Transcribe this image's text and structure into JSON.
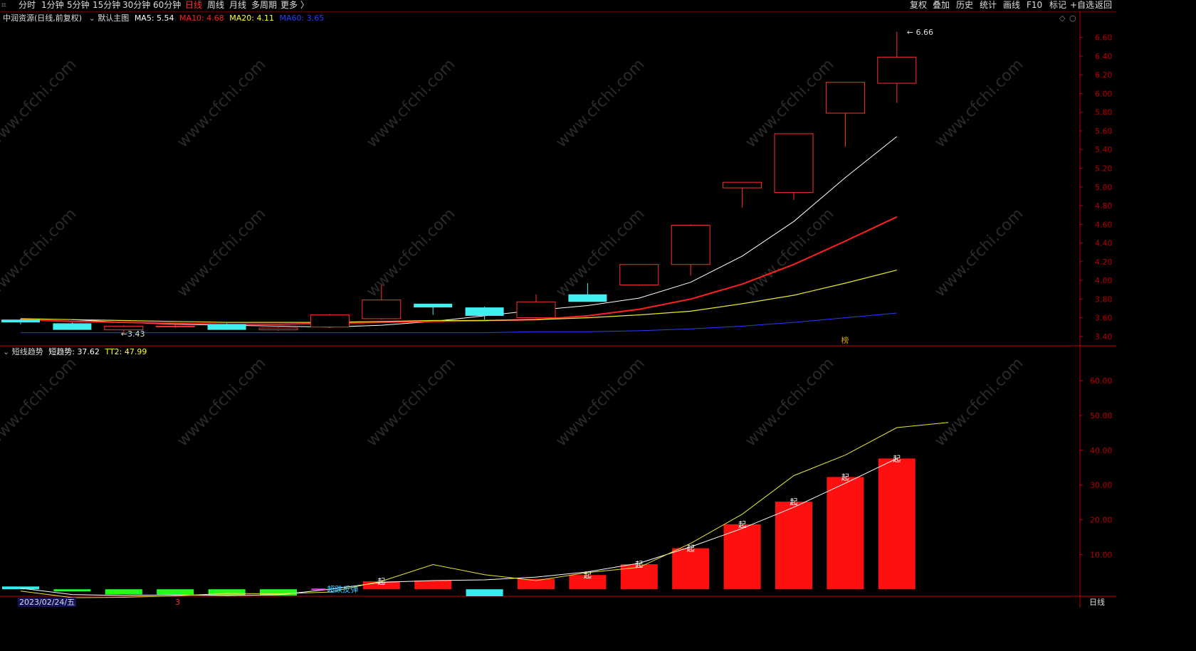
{
  "toolbar": {
    "periods": [
      "分时",
      "1分钟",
      "5分钟",
      "15分钟",
      "30分钟",
      "60分钟",
      "日线",
      "周线",
      "月线",
      "多周期",
      "更多 〉"
    ],
    "selected_period": "日线",
    "right_buttons": [
      "复权",
      "叠加",
      "历史",
      "统计",
      "画线",
      "F10",
      "标记",
      "+自选",
      "返回"
    ]
  },
  "main_header": {
    "stock": "中润资源(日线,前复权)",
    "template": "默认主图",
    "ma": [
      {
        "label": "MA5:",
        "value": "5.54",
        "color": "#ffffff"
      },
      {
        "label": "MA10:",
        "value": "4.68",
        "color": "#ff2020"
      },
      {
        "label": "MA20:",
        "value": "4.11",
        "color": "#ffff33"
      },
      {
        "label": "MA60:",
        "value": "3.65",
        "color": "#2a3cff"
      }
    ]
  },
  "sub_header": {
    "name": "短线趋势",
    "items": [
      {
        "label": "短趋势:",
        "value": "37.62",
        "color": "#ffffff"
      },
      {
        "label": "TT2:",
        "value": "47.99",
        "color": "#ffff33"
      }
    ]
  },
  "annotations": {
    "high_label": "6.66",
    "low_label": "3.43",
    "board_label": "榜",
    "signal_char": "起",
    "signal_text": "超跌反弹"
  },
  "date_axis": {
    "current_date": "2023/02/24/五",
    "marker": "3"
  },
  "bottom_right_label": "日线",
  "watermark": "www.cfchi.com",
  "colors": {
    "up": "#ff3030",
    "down": "#40f0f0",
    "axis": "#b80000",
    "ma5": "#ffffff",
    "ma10": "#ff2020",
    "ma20": "#e8e830",
    "ma60": "#2a3cff",
    "bar_up": "#ff1010",
    "bar_down": "#20ff20",
    "bar_flat": "#30f0f0"
  },
  "chart_data": [
    {
      "type": "candlestick",
      "title": "中润资源(日线,前复权)",
      "ylim": [
        3.33,
        6.75
      ],
      "y_ticks": [
        3.4,
        3.6,
        3.8,
        4.0,
        4.2,
        4.4,
        4.6,
        4.8,
        5.0,
        5.2,
        5.4,
        5.6,
        5.8,
        6.0,
        6.2,
        6.4,
        6.6
      ],
      "candles": [
        {
          "o": 3.58,
          "h": 3.59,
          "l": 3.53,
          "c": 3.55
        },
        {
          "o": 3.54,
          "h": 3.55,
          "l": 3.47,
          "c": 3.47
        },
        {
          "o": 3.47,
          "h": 3.52,
          "l": 3.43,
          "c": 3.51
        },
        {
          "o": 3.51,
          "h": 3.53,
          "l": 3.49,
          "c": 3.51
        },
        {
          "o": 3.53,
          "h": 3.54,
          "l": 3.47,
          "c": 3.47
        },
        {
          "o": 3.47,
          "h": 3.5,
          "l": 3.46,
          "c": 3.49
        },
        {
          "o": 3.5,
          "h": 3.64,
          "l": 3.49,
          "c": 3.63
        },
        {
          "o": 3.59,
          "h": 3.95,
          "l": 3.58,
          "c": 3.79
        },
        {
          "o": 3.75,
          "h": 3.75,
          "l": 3.63,
          "c": 3.71
        },
        {
          "o": 3.71,
          "h": 3.72,
          "l": 3.58,
          "c": 3.62
        },
        {
          "o": 3.6,
          "h": 3.85,
          "l": 3.59,
          "c": 3.77
        },
        {
          "o": 3.85,
          "h": 3.97,
          "l": 3.77,
          "c": 3.77
        },
        {
          "o": 3.95,
          "h": 4.17,
          "l": 3.94,
          "c": 4.17
        },
        {
          "o": 4.17,
          "h": 4.6,
          "l": 4.05,
          "c": 4.59
        },
        {
          "o": 4.99,
          "h": 5.05,
          "l": 4.78,
          "c": 5.05
        },
        {
          "o": 4.94,
          "h": 5.57,
          "l": 4.86,
          "c": 5.57
        },
        {
          "o": 5.79,
          "h": 6.12,
          "l": 5.43,
          "c": 6.12
        },
        {
          "o": 6.11,
          "h": 6.66,
          "l": 5.9,
          "c": 6.39
        }
      ],
      "series": [
        {
          "name": "MA5",
          "values": [
            3.58,
            3.55,
            3.53,
            3.52,
            3.51,
            3.5,
            3.52,
            3.56,
            3.62,
            3.68,
            3.73,
            3.81,
            3.98,
            4.26,
            4.63,
            5.1,
            5.54
          ]
        },
        {
          "name": "MA10",
          "values": [
            3.58,
            3.56,
            3.55,
            3.54,
            3.53,
            3.53,
            3.54,
            3.55,
            3.56,
            3.57,
            3.58,
            3.62,
            3.69,
            3.8,
            3.96,
            4.17,
            4.42,
            4.68
          ]
        },
        {
          "name": "MA20",
          "values": [
            3.59,
            3.58,
            3.57,
            3.56,
            3.55,
            3.55,
            3.55,
            3.56,
            3.57,
            3.57,
            3.58,
            3.6,
            3.63,
            3.67,
            3.75,
            3.84,
            3.97,
            4.11
          ]
        },
        {
          "name": "MA60",
          "values": [
            3.44,
            3.44,
            3.44,
            3.44,
            3.44,
            3.44,
            3.44,
            3.44,
            3.44,
            3.44,
            3.45,
            3.45,
            3.46,
            3.48,
            3.51,
            3.55,
            3.6,
            3.65
          ]
        }
      ]
    },
    {
      "type": "bar",
      "title": "短线趋势",
      "ylim": [
        -2,
        68
      ],
      "y_ticks": [
        10,
        20,
        30,
        40,
        50,
        60
      ],
      "bars": [
        {
          "v": 0.8,
          "kind": "flat"
        },
        {
          "v": -0.6,
          "kind": "down"
        },
        {
          "v": -1.5,
          "kind": "down"
        },
        {
          "v": -1.5,
          "kind": "down"
        },
        {
          "v": -1.8,
          "kind": "down"
        },
        {
          "v": -1.8,
          "kind": "down"
        },
        {
          "v": 0.0,
          "kind": "none"
        },
        {
          "v": 2.3,
          "kind": "up"
        },
        {
          "v": 2.5,
          "kind": "up"
        },
        {
          "v": -2.0,
          "kind": "flat"
        },
        {
          "v": 3.0,
          "kind": "up"
        },
        {
          "v": 4.1,
          "kind": "up"
        },
        {
          "v": 7.2,
          "kind": "up"
        },
        {
          "v": 11.8,
          "kind": "up"
        },
        {
          "v": 18.7,
          "kind": "up"
        },
        {
          "v": 25.2,
          "kind": "up"
        },
        {
          "v": 32.3,
          "kind": "up"
        },
        {
          "v": 37.62,
          "kind": "up"
        }
      ],
      "signal_days": [
        7,
        11,
        12,
        13,
        14,
        15,
        16,
        17
      ],
      "series": [
        {
          "name": "短趋势",
          "values": [
            0.3,
            -1.5,
            -1.8,
            -1.6,
            -1.8,
            -1.6,
            0.0,
            2.0,
            2.5,
            2.7,
            3.5,
            5.0,
            7.5,
            12.2,
            17.5,
            23.6,
            30.5,
            37.62
          ]
        },
        {
          "name": "TT2",
          "values": [
            -0.5,
            -2.4,
            -2.3,
            -1.9,
            -1.2,
            -1.3,
            -0.8,
            2.3,
            7.1,
            4.2,
            2.5,
            4.8,
            6.3,
            13.2,
            21.6,
            32.7,
            38.6,
            46.5,
            47.99
          ]
        }
      ]
    }
  ]
}
